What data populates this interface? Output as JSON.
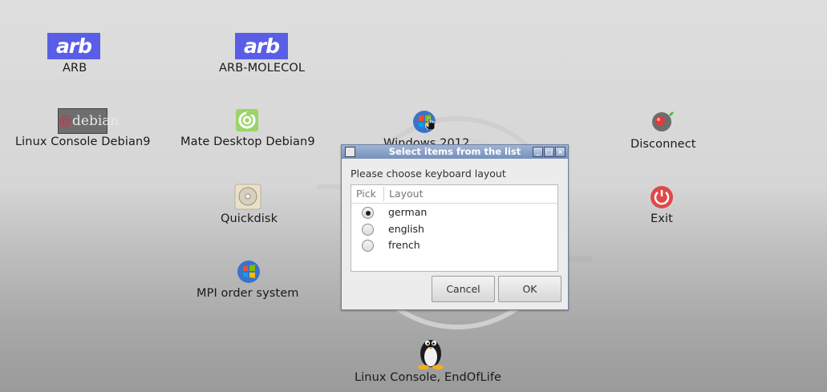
{
  "desktop": {
    "icons": [
      {
        "label": "ARB",
        "logo_text": "arb"
      },
      {
        "label": "ARB-MOLECOL",
        "logo_text": "arb"
      },
      {
        "label": "Linux Console Debian9",
        "logo_text": "debian"
      },
      {
        "label": "Mate Desktop Debian9"
      },
      {
        "label": "Windows 2012"
      },
      {
        "label": "Disconnect"
      },
      {
        "label": "Quickdisk"
      },
      {
        "label": "Exit"
      },
      {
        "label": "MPI order system"
      },
      {
        "label": "Linux Console, EndOfLife"
      }
    ]
  },
  "dialog": {
    "title": "Select items from the list",
    "prompt": "Please choose keyboard layout",
    "columns": [
      "Pick",
      "Layout"
    ],
    "options": [
      {
        "label": "german",
        "selected": true
      },
      {
        "label": "english",
        "selected": false
      },
      {
        "label": "french",
        "selected": false
      }
    ],
    "cancel_label": "Cancel",
    "ok_label": "OK"
  },
  "colors": {
    "title_bar": "#7f98c3",
    "arb_logo": "#5a5ee6",
    "exit_red": "#e04848"
  }
}
